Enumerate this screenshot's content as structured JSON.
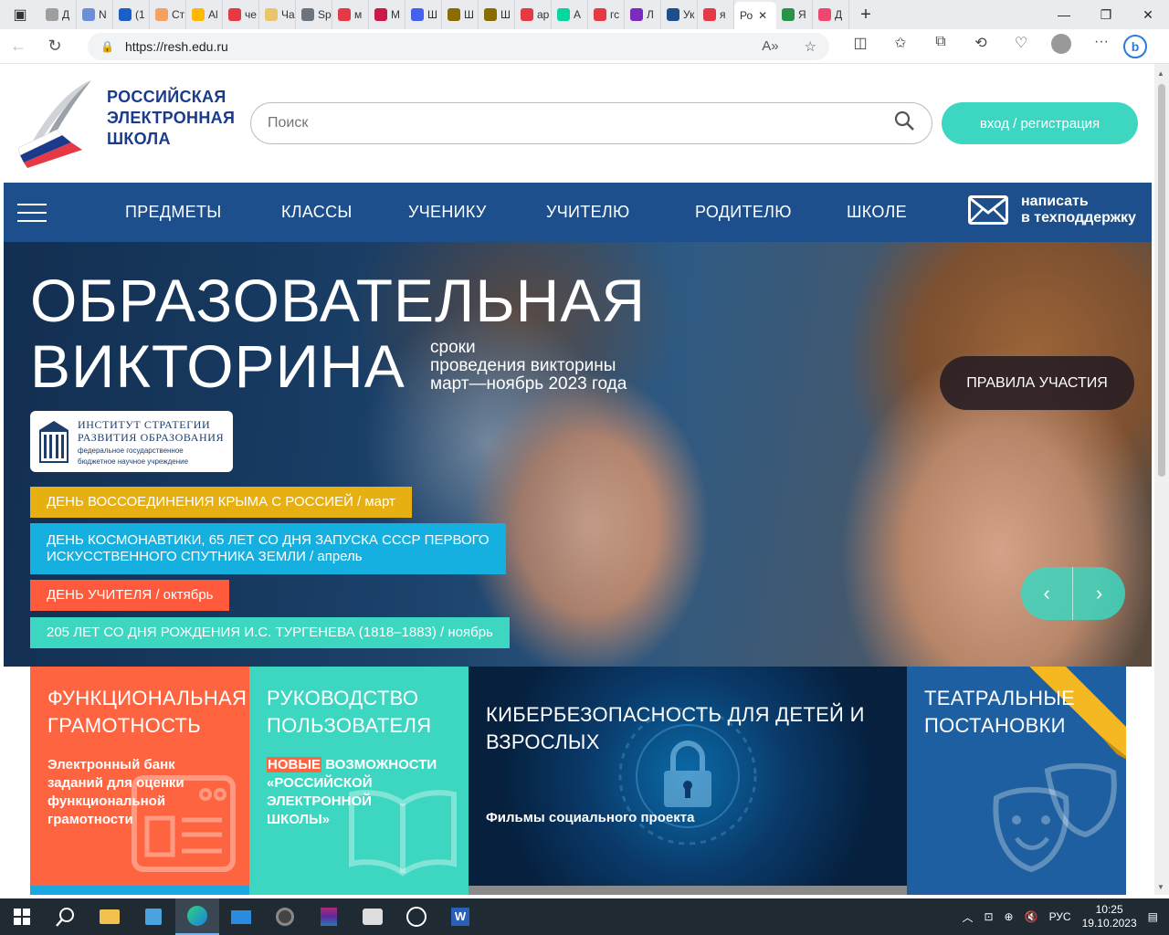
{
  "browser": {
    "tabs": [
      {
        "label": "Д",
        "color": "#9e9e9e"
      },
      {
        "label": "N",
        "color": "#6b8fd6"
      },
      {
        "label": "(1",
        "color": "#1a5fc9"
      },
      {
        "label": "Ст",
        "color": "#f4a261"
      },
      {
        "label": "Al",
        "color": "#ffb703"
      },
      {
        "label": "че",
        "color": "#e63946"
      },
      {
        "label": "Ча",
        "color": "#e9c46a"
      },
      {
        "label": "Sp",
        "color": "#6c757d"
      },
      {
        "label": "м",
        "color": "#e63946"
      },
      {
        "label": "M",
        "color": "#c9184a"
      },
      {
        "label": "Ш",
        "color": "#4361ee"
      },
      {
        "label": "Ш",
        "color": "#8a6d00"
      },
      {
        "label": "Ш",
        "color": "#8a6d00"
      },
      {
        "label": "ар",
        "color": "#e63946"
      },
      {
        "label": "А",
        "color": "#06d6a0"
      },
      {
        "label": "гс",
        "color": "#e63946"
      },
      {
        "label": "Л",
        "color": "#7b2cbf"
      },
      {
        "label": "Ук",
        "color": "#1d4f8c"
      },
      {
        "label": "я",
        "color": "#e63946"
      },
      {
        "label": "Я",
        "color": "#2b9348"
      },
      {
        "label": "Д",
        "color": "#ef476f"
      }
    ],
    "active_tab": {
      "label": "Ро",
      "close": "✕"
    },
    "new_tab": "+",
    "url": "https://resh.edu.ru"
  },
  "site": {
    "logo_lines": [
      "РОССИЙСКАЯ",
      "ЭЛЕКТРОННАЯ",
      "ШКОЛА"
    ],
    "search_placeholder": "Поиск",
    "login_button": "вход / регистрация",
    "nav": [
      "ПРЕДМЕТЫ",
      "КЛАССЫ",
      "УЧЕНИКУ",
      "УЧИТЕЛЮ",
      "РОДИТЕЛЮ",
      "ШКОЛЕ"
    ],
    "support_lines": [
      "написать",
      "в техподдержку"
    ],
    "brand_color": "#1d4f8c",
    "accent_color": "#3dd6c0"
  },
  "hero": {
    "title_lines": [
      "ОБРАЗОВАТЕЛЬНАЯ",
      "ВИКТОРИНА"
    ],
    "subtitle_lines": [
      "сроки",
      "проведения викторины",
      "март—ноябрь 2023 года"
    ],
    "rules_button": "ПРАВИЛА УЧАСТИЯ",
    "institute": {
      "name_lines": [
        "ИНСТИТУТ СТРАТЕГИИ",
        "РАЗВИТИЯ ОБРАЗОВАНИЯ"
      ],
      "desc_lines": [
        "федеральное государственное",
        "бюджетное научное учреждение"
      ]
    },
    "tags": [
      {
        "lines": [
          "ДЕНЬ ВОССОЕДИНЕНИЯ КРЫМА С РОССИЕЙ / март"
        ],
        "color": "#e6b012"
      },
      {
        "lines": [
          "ДЕНЬ КОСМОНАВТИКИ, 65 ЛЕТ СО ДНЯ ЗАПУСКА СССР ПЕРВОГО",
          "ИСКУССТВЕННОГО СПУТНИКА ЗЕМЛИ / апрель"
        ],
        "color": "#15b0e0"
      },
      {
        "lines": [
          "ДЕНЬ УЧИТЕЛЯ / октябрь"
        ],
        "color": "#ff5a3c"
      },
      {
        "lines": [
          "205 ЛЕТ СО ДНЯ РОЖДЕНИЯ И.С. ТУРГЕНЕВА (1818–1883) / ноябрь"
        ],
        "color": "#3dd6c0"
      }
    ],
    "prev_arrow": "‹",
    "next_arrow": "›"
  },
  "tiles": [
    {
      "title_lines": [
        "ФУНКЦИОНАЛЬНАЯ",
        "ГРАМОТНОСТЬ"
      ],
      "text_lines": [
        "Электронный банк",
        "заданий для оценки",
        "функциональной",
        "грамотности"
      ]
    },
    {
      "title_lines": [
        "РУКОВОДСТВО",
        "ПОЛЬЗОВАТЕЛЯ"
      ],
      "highlight": "НОВЫЕ",
      "text_lines": [
        " ВОЗМОЖНОСТИ",
        "«РОССИЙСКОЙ",
        "ЭЛЕКТРОННОЙ",
        "ШКОЛЫ»"
      ]
    },
    {
      "title_lines": [
        "КИБЕРБЕЗОПАСНОСТЬ ДЛЯ ДЕТЕЙ И",
        "ВЗРОСЛЫХ"
      ],
      "text_lines": [
        "Фильмы социального проекта"
      ]
    },
    {
      "title_lines": [
        "ТЕАТРАЛЬНЫЕ",
        "ПОСТАНОВКИ"
      ],
      "text_lines": []
    }
  ],
  "taskbar": {
    "lang": "РУС",
    "time": "10:25",
    "date": "19.10.2023"
  }
}
